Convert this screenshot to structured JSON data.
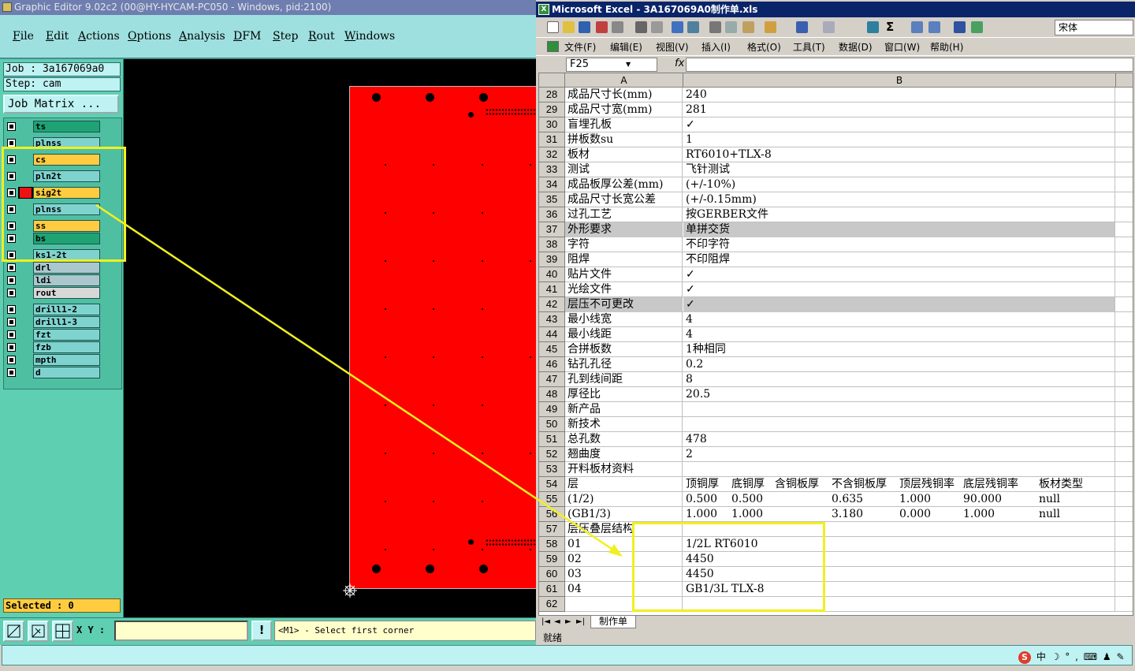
{
  "ge": {
    "title": "Graphic Editor 9.02c2 (00@HY-HYCAM-PC050 - Windows, pid:2100)",
    "menu": [
      "File",
      "Edit",
      "Actions",
      "Options",
      "Analysis",
      "DFM",
      "Step",
      "Rout",
      "Windows"
    ],
    "job": "Job : 3a167069a0",
    "step": "Step: cam",
    "job_matrix": "Job Matrix ...",
    "layers": [
      {
        "name": "ts",
        "color": "#1fa374"
      },
      {
        "name": "plnss",
        "color": "#7fd3cf"
      },
      {
        "name": "cs",
        "color": "#ffcc40"
      },
      {
        "name": "pln2t",
        "color": "#7fd3cf"
      },
      {
        "name": "sig2t",
        "color": "#ffcc40"
      },
      {
        "name": "plnss",
        "color": "#7fd3cf"
      },
      {
        "name": "ss",
        "color": "#ffcc40"
      },
      {
        "name": "bs",
        "color": "#1fa374"
      },
      {
        "name": "ks1-2t",
        "color": "#7fd3cf"
      },
      {
        "name": "drl",
        "color": "#a9c7cc"
      },
      {
        "name": "ldi",
        "color": "#a9c7cc"
      },
      {
        "name": "rout",
        "color": "#d8d8d8"
      },
      {
        "name": "drill1-2",
        "color": "#7fd3cf"
      },
      {
        "name": "drill1-3",
        "color": "#7fd3cf"
      },
      {
        "name": "fzt",
        "color": "#7fd3cf"
      },
      {
        "name": "fzb",
        "color": "#7fd3cf"
      },
      {
        "name": "mpth",
        "color": "#7fd3cf"
      },
      {
        "name": "d",
        "color": "#7fd3cf"
      }
    ],
    "selected": "Selected : 0",
    "xy_label": "X Y :",
    "warn": "!",
    "prompt": "<M1> - Select first corner"
  },
  "xl": {
    "title": "Microsoft Excel - 3A167069A0制作单.xls",
    "font_name": "宋体",
    "menu": [
      "文件(F)",
      "编辑(E)",
      "视图(V)",
      "插入(I)",
      "格式(O)",
      "工具(T)",
      "数据(D)",
      "窗口(W)",
      "帮助(H)"
    ],
    "name_box": "F25",
    "fx": "fx",
    "col_a": "A",
    "col_b": "B",
    "rows": [
      {
        "n": "28",
        "a": "成品尺寸长(mm)",
        "b": "240"
      },
      {
        "n": "29",
        "a": "成品尺寸宽(mm)",
        "b": "281"
      },
      {
        "n": "30",
        "a": "盲埋孔板",
        "b": "✓"
      },
      {
        "n": "31",
        "a": "拼板数su",
        "b": "1"
      },
      {
        "n": "32",
        "a": "板材",
        "b": "RT6010+TLX-8"
      },
      {
        "n": "33",
        "a": "测试",
        "b": "飞针测试"
      },
      {
        "n": "34",
        "a": "成品板厚公差(mm)",
        "b": "(+/-10%)"
      },
      {
        "n": "35",
        "a": "成品尺寸长宽公差",
        "b": "(+/-0.15mm)"
      },
      {
        "n": "36",
        "a": "过孔工艺",
        "b": "按GERBER文件"
      },
      {
        "n": "37",
        "a": "外形要求",
        "b": "单拼交货",
        "shaded": true
      },
      {
        "n": "38",
        "a": "字符",
        "b": "不印字符"
      },
      {
        "n": "39",
        "a": "阻焊",
        "b": "不印阻焊"
      },
      {
        "n": "40",
        "a": "贴片文件",
        "b": "✓"
      },
      {
        "n": "41",
        "a": "光绘文件",
        "b": "✓"
      },
      {
        "n": "42",
        "a": "层压不可更改",
        "b": "✓",
        "shaded": true
      },
      {
        "n": "43",
        "a": "最小线宽",
        "b": "4"
      },
      {
        "n": "44",
        "a": "最小线距",
        "b": "4"
      },
      {
        "n": "45",
        "a": "合拼板数",
        "b": "1种相同"
      },
      {
        "n": "46",
        "a": "钻孔孔径",
        "b": "0.2"
      },
      {
        "n": "47",
        "a": "孔到线间距",
        "b": "8"
      },
      {
        "n": "48",
        "a": "厚径比",
        "b": "20.5"
      },
      {
        "n": "49",
        "a": "新产品",
        "b": ""
      },
      {
        "n": "50",
        "a": "新技术",
        "b": ""
      },
      {
        "n": "51",
        "a": "总孔数",
        "b": "478"
      },
      {
        "n": "52",
        "a": "翘曲度",
        "b": "2"
      },
      {
        "n": "53",
        "a": "开料板材资料",
        "b": ""
      },
      {
        "n": "54",
        "a": "层",
        "b": "",
        "cols": [
          "顶铜厚",
          "底铜厚",
          "含铜板厚",
          "不含铜板厚",
          "顶层残铜率",
          "底层残铜率",
          "板材类型"
        ]
      },
      {
        "n": "55",
        "a": "(1/2)",
        "b": "",
        "cols": [
          "0.500",
          "0.500",
          "",
          "0.635",
          "1.000",
          "90.000",
          "null"
        ]
      },
      {
        "n": "56",
        "a": "(GB1/3)",
        "b": "",
        "cols": [
          "1.000",
          "1.000",
          "",
          "3.180",
          "0.000",
          "1.000",
          "null"
        ]
      },
      {
        "n": "57",
        "a": "层压叠层结构",
        "b": ""
      },
      {
        "n": "58",
        "a": "01",
        "b": "1/2L RT6010"
      },
      {
        "n": "59",
        "a": "02",
        "b": "4450"
      },
      {
        "n": "60",
        "a": "03",
        "b": "4450"
      },
      {
        "n": "61",
        "a": "04",
        "b": "GB1/3L TLX-8"
      },
      {
        "n": "62",
        "a": "",
        "b": ""
      }
    ],
    "sheet_tab": "制作单",
    "status": "就绪"
  },
  "ime": [
    "中",
    "☽",
    "°",
    ",",
    "⌨",
    "♟",
    "✎"
  ],
  "ime_s": "S",
  "colors": {
    "highlight": "#f0f020",
    "board": "#ff0000",
    "title_active": "#0a246a"
  }
}
